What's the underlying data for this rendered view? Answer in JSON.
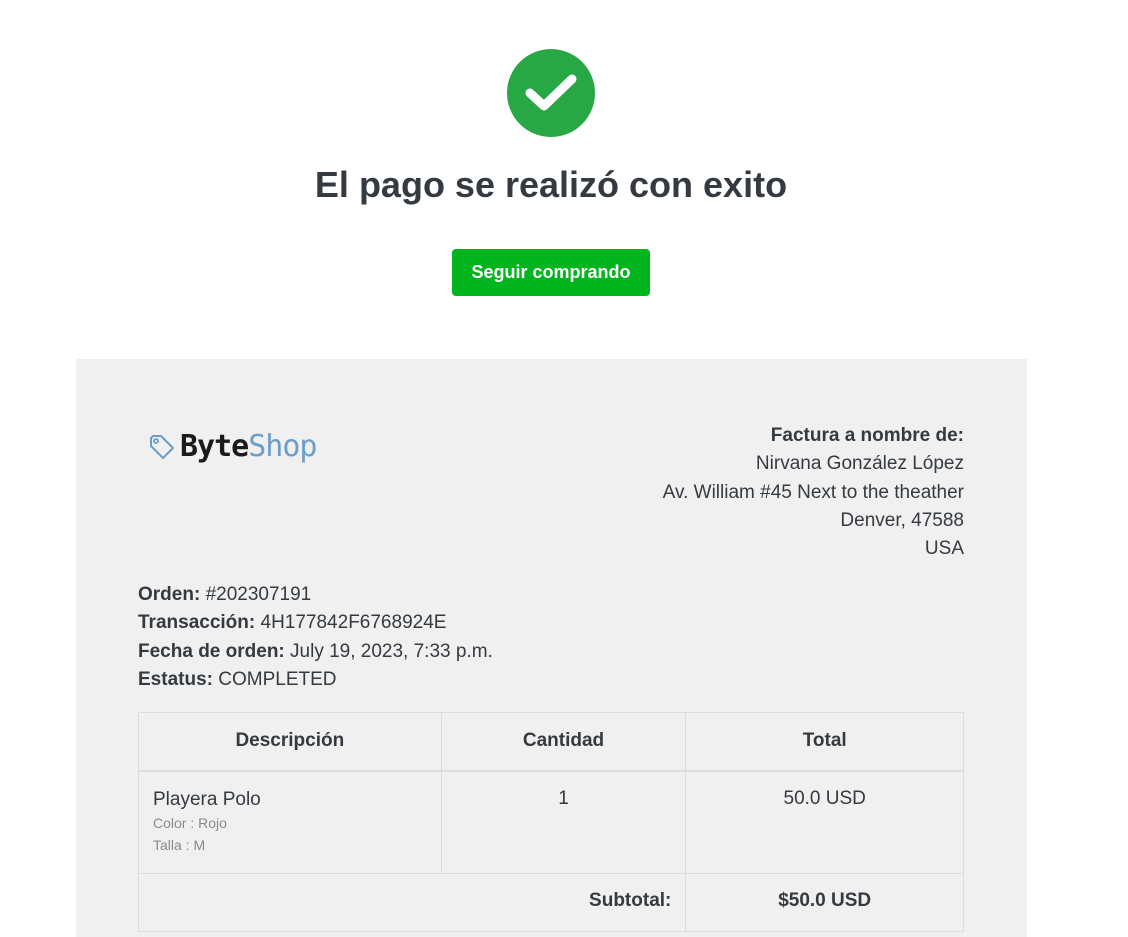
{
  "header": {
    "title": "El pago se realizó con exito",
    "continue_label": "Seguir comprando",
    "success_icon": "check-circle-icon",
    "success_color": "#28a745",
    "button_color": "#00b51d"
  },
  "invoice": {
    "logo": {
      "part1": "Byte",
      "part2": "Shop",
      "icon": "tag-icon"
    },
    "bill_to": {
      "heading": "Factura a nombre de:",
      "name": "Nirvana González López",
      "address": "Av. William #45 Next to the theather",
      "city": "Denver, 47588",
      "country": "USA"
    },
    "order": {
      "order_label": "Orden:",
      "order_value": "#202307191",
      "transaction_label": "Transacción:",
      "transaction_value": "4H177842F6768924E",
      "date_label": "Fecha de orden:",
      "date_value": "July 19, 2023, 7:33 p.m.",
      "status_label": "Estatus:",
      "status_value": "COMPLETED"
    },
    "table": {
      "headers": [
        "Descripción",
        "Cantidad",
        "Total"
      ],
      "items": [
        {
          "name": "Playera Polo",
          "color": "Color : Rojo",
          "size": "Talla : M",
          "quantity": "1",
          "total": "50.0 USD"
        }
      ],
      "subtotal_label": "Subtotal:",
      "subtotal_value": "$50.0 USD"
    }
  }
}
